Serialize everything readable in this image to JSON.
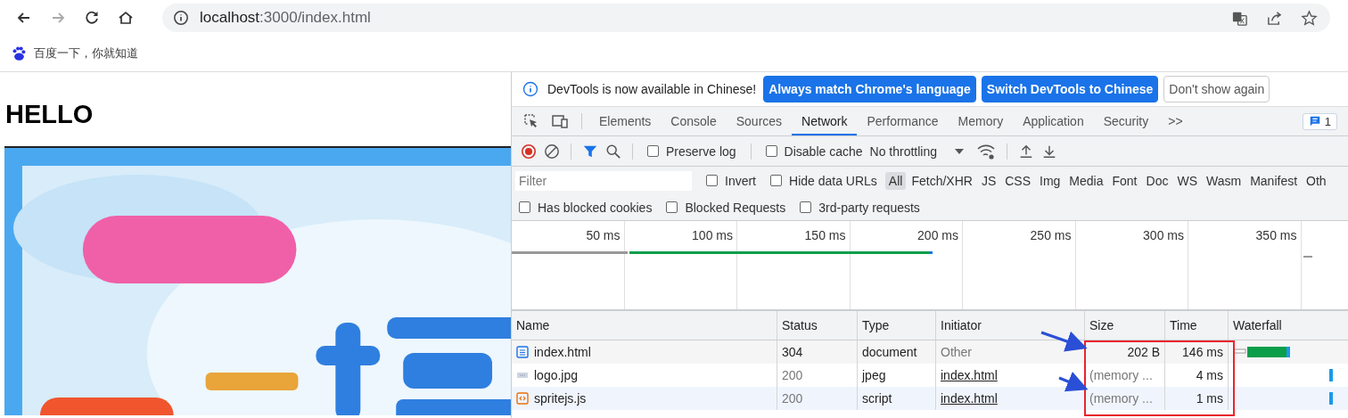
{
  "browser": {
    "url_host": "localhost",
    "url_path": ":3000/index.html",
    "bookmarks": [
      {
        "label": "百度一下，你就知道"
      }
    ]
  },
  "page": {
    "heading": "HELLO"
  },
  "devtools": {
    "infobar": {
      "message": "DevTools is now available in Chinese!",
      "buttons": [
        {
          "label": "Always match Chrome's language",
          "kind": "primary"
        },
        {
          "label": "Switch DevTools to Chinese",
          "kind": "primary"
        },
        {
          "label": "Don't show again",
          "kind": "plain"
        }
      ]
    },
    "tabs": [
      {
        "label": "Elements",
        "selected": false
      },
      {
        "label": "Console",
        "selected": false
      },
      {
        "label": "Sources",
        "selected": false
      },
      {
        "label": "Network",
        "selected": true
      },
      {
        "label": "Performance",
        "selected": false
      },
      {
        "label": "Memory",
        "selected": false
      },
      {
        "label": "Application",
        "selected": false
      },
      {
        "label": "Security",
        "selected": false
      }
    ],
    "more_tabs": ">>",
    "issues_badge": "1",
    "toolbar": {
      "preserve_log": {
        "label": "Preserve log",
        "checked": false
      },
      "disable_cache": {
        "label": "Disable cache",
        "checked": false
      },
      "throttling": "No throttling"
    },
    "filter": {
      "placeholder": "Filter",
      "invert": {
        "label": "Invert",
        "checked": false
      },
      "hide_data_urls": {
        "label": "Hide data URLs",
        "checked": false
      },
      "types": [
        {
          "label": "All",
          "selected": true
        },
        {
          "label": "Fetch/XHR",
          "selected": false
        },
        {
          "label": "JS",
          "selected": false
        },
        {
          "label": "CSS",
          "selected": false
        },
        {
          "label": "Img",
          "selected": false
        },
        {
          "label": "Media",
          "selected": false
        },
        {
          "label": "Font",
          "selected": false
        },
        {
          "label": "Doc",
          "selected": false
        },
        {
          "label": "WS",
          "selected": false
        },
        {
          "label": "Wasm",
          "selected": false
        },
        {
          "label": "Manifest",
          "selected": false
        },
        {
          "label": "Oth",
          "selected": false
        }
      ]
    },
    "blocked_filters": [
      {
        "label": "Has blocked cookies",
        "checked": false
      },
      {
        "label": "Blocked Requests",
        "checked": false
      },
      {
        "label": "3rd-party requests",
        "checked": false
      }
    ],
    "overview_ticks": [
      "50 ms",
      "100 ms",
      "150 ms",
      "200 ms",
      "250 ms",
      "300 ms",
      "350 ms"
    ],
    "table": {
      "columns": [
        "Name",
        "Status",
        "Type",
        "Initiator",
        "Size",
        "Time",
        "Waterfall"
      ],
      "rows": [
        {
          "kind": "doc",
          "name": "index.html",
          "status": "304",
          "type": "document",
          "initiator": "Other",
          "initiator_link": false,
          "size": "202 B",
          "time": "146 ms",
          "from_cache": false
        },
        {
          "kind": "img",
          "name": "logo.jpg",
          "status": "200",
          "type": "jpeg",
          "initiator": "index.html",
          "initiator_link": true,
          "size": "(memory ...",
          "time": "4 ms",
          "from_cache": true
        },
        {
          "kind": "js",
          "name": "spritejs.js",
          "status": "200",
          "type": "script",
          "initiator": "index.html",
          "initiator_link": true,
          "size": "(memory ...",
          "time": "1 ms",
          "from_cache": true
        }
      ]
    }
  }
}
